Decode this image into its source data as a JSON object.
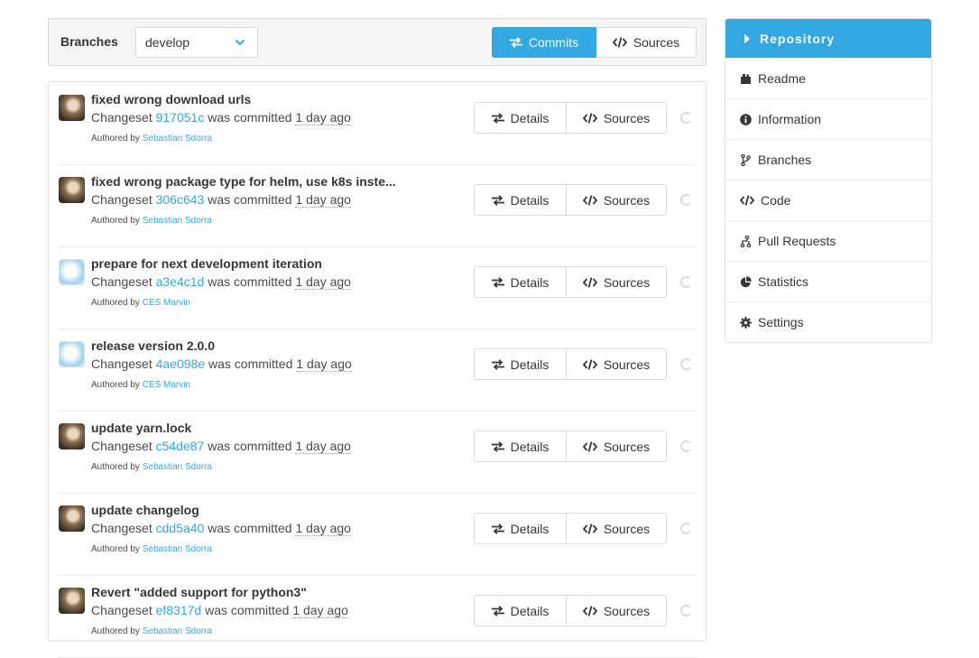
{
  "toolbar": {
    "branch_label": "Branches",
    "branch_value": "develop",
    "commits_label": "Commits",
    "sources_label": "Sources"
  },
  "changesets": [
    {
      "title": "fixed wrong download urls",
      "prefix": "Changeset",
      "hash": "917051c",
      "middle": "was committed",
      "date": "1 day ago",
      "authored_by": "Authored by",
      "author": "Sebastian Sdorra",
      "avatar": "photo"
    },
    {
      "title": "fixed wrong package type for helm, use k8s inste...",
      "prefix": "Changeset",
      "hash": "306c643",
      "middle": "was committed",
      "date": "1 day ago",
      "authored_by": "Authored by",
      "author": "Sebastian Sdorra",
      "avatar": "photo"
    },
    {
      "title": "prepare for next development iteration",
      "prefix": "Changeset",
      "hash": "a3e4c1d",
      "middle": "was committed",
      "date": "1 day ago",
      "authored_by": "Authored by",
      "author": "CES Marvin",
      "avatar": "ces"
    },
    {
      "title": "release version 2.0.0",
      "prefix": "Changeset",
      "hash": "4ae098e",
      "middle": "was committed",
      "date": "1 day ago",
      "authored_by": "Authored by",
      "author": "CES Marvin",
      "avatar": "ces"
    },
    {
      "title": "update yarn.lock",
      "prefix": "Changeset",
      "hash": "c54de87",
      "middle": "was committed",
      "date": "1 day ago",
      "authored_by": "Authored by",
      "author": "Sebastian Sdorra",
      "avatar": "photo"
    },
    {
      "title": "update changelog",
      "prefix": "Changeset",
      "hash": "cdd5a40",
      "middle": "was committed",
      "date": "1 day ago",
      "authored_by": "Authored by",
      "author": "Sebastian Sdorra",
      "avatar": "photo"
    },
    {
      "title": "Revert \"added support for python3\"",
      "prefix": "Changeset",
      "hash": "ef8317d",
      "middle": "was committed",
      "date": "1 day ago",
      "authored_by": "Authored by",
      "author": "Sebastian Sdorra",
      "avatar": "photo"
    }
  ],
  "row_buttons": {
    "details": "Details",
    "sources": "Sources"
  },
  "sidebar": {
    "header": "Repository",
    "items": [
      {
        "label": "Readme",
        "icon": "book-icon"
      },
      {
        "label": "Information",
        "icon": "info-icon"
      },
      {
        "label": "Branches",
        "icon": "branch-icon"
      },
      {
        "label": "Code",
        "icon": "code-icon"
      },
      {
        "label": "Pull Requests",
        "icon": "pull-request-icon"
      },
      {
        "label": "Statistics",
        "icon": "pie-chart-icon"
      },
      {
        "label": "Settings",
        "icon": "gear-icon"
      }
    ]
  },
  "colors": {
    "accent": "#33a8e0",
    "text": "#363636",
    "border": "#dbdbdb"
  }
}
